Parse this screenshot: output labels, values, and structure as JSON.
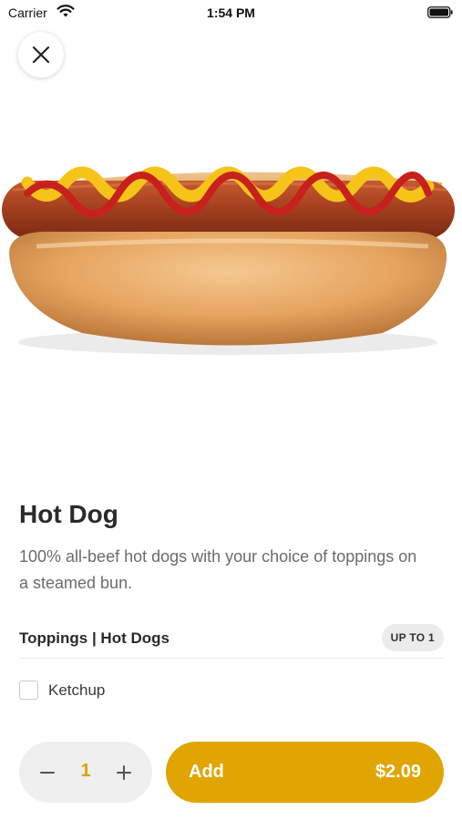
{
  "status_bar": {
    "carrier": "Carrier",
    "time": "1:54 PM",
    "icons": [
      "wifi-icon",
      "battery-icon"
    ]
  },
  "close_icon": "close-icon",
  "product": {
    "name": "Hot Dog",
    "description": "100% all-beef hot dogs with your choice of toppings on a steamed bun.",
    "image": "hot-dog-photo"
  },
  "options_section": {
    "title": "Toppings | Hot Dogs",
    "badge": "UP TO 1",
    "items": [
      {
        "label": "Ketchup",
        "checked": false
      }
    ]
  },
  "quantity": {
    "value": "1",
    "minus_icon": "minus-icon",
    "plus_icon": "plus-icon"
  },
  "add_button": {
    "label": "Add",
    "price": "$2.09"
  },
  "colors": {
    "accent": "#e0a500",
    "quantity_text": "#d9a400",
    "stepper_bg": "#efefef",
    "badge_bg": "#ececec"
  }
}
